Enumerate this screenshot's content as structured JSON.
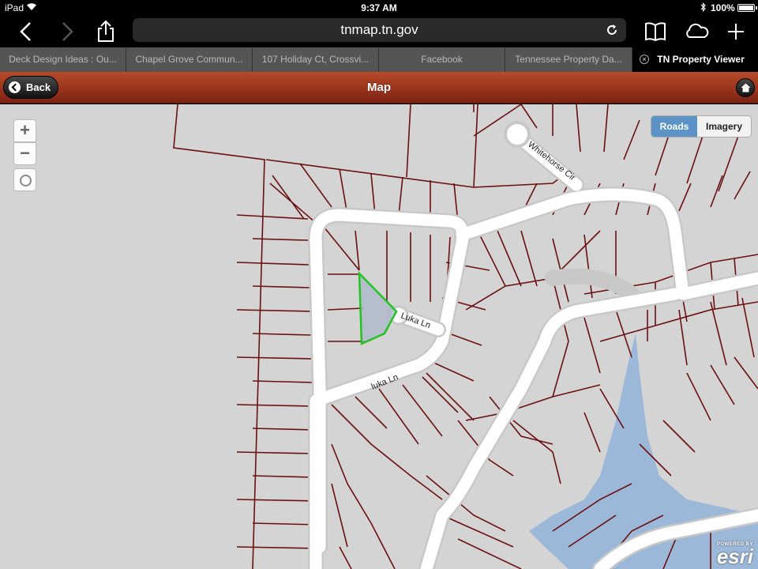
{
  "status_bar": {
    "carrier": "iPad",
    "time": "9:37 AM",
    "battery": "100%",
    "icons": [
      "wifi-icon",
      "bluetooth-icon",
      "battery-icon"
    ]
  },
  "browser": {
    "url": "tnmap.tn.gov",
    "toolbar_icons": [
      "back-arrow-icon",
      "forward-arrow-icon",
      "share-icon",
      "reload-icon",
      "bookmarks-icon",
      "icloud-tabs-icon",
      "new-tab-icon"
    ],
    "tabs": [
      {
        "label": "Deck Design Ideas : Ou..."
      },
      {
        "label": "Chapel Grove Commun..."
      },
      {
        "label": "107 Holiday Ct, Crossvi..."
      },
      {
        "label": "Facebook"
      },
      {
        "label": "Tennessee Property Da..."
      },
      {
        "label": "TN Property Viewer",
        "active": true
      }
    ]
  },
  "app_header": {
    "back_label": "Back",
    "title": "Map"
  },
  "map": {
    "zoom_in": "+",
    "zoom_out": "−",
    "basemap_options": [
      "Roads",
      "Imagery"
    ],
    "basemap_selected": "Roads",
    "road_labels": [
      "Whitehorse Cir",
      "Luka Ln",
      "luka Ln"
    ],
    "attribution_small": "POWERED BY",
    "attribution_logo": "esri",
    "colors": {
      "background": "#d4d4d4",
      "parcel_lines": "#6b1010",
      "road": "#ffffff",
      "water": "#9bb8d9",
      "selected_parcel": "#22c422"
    }
  }
}
